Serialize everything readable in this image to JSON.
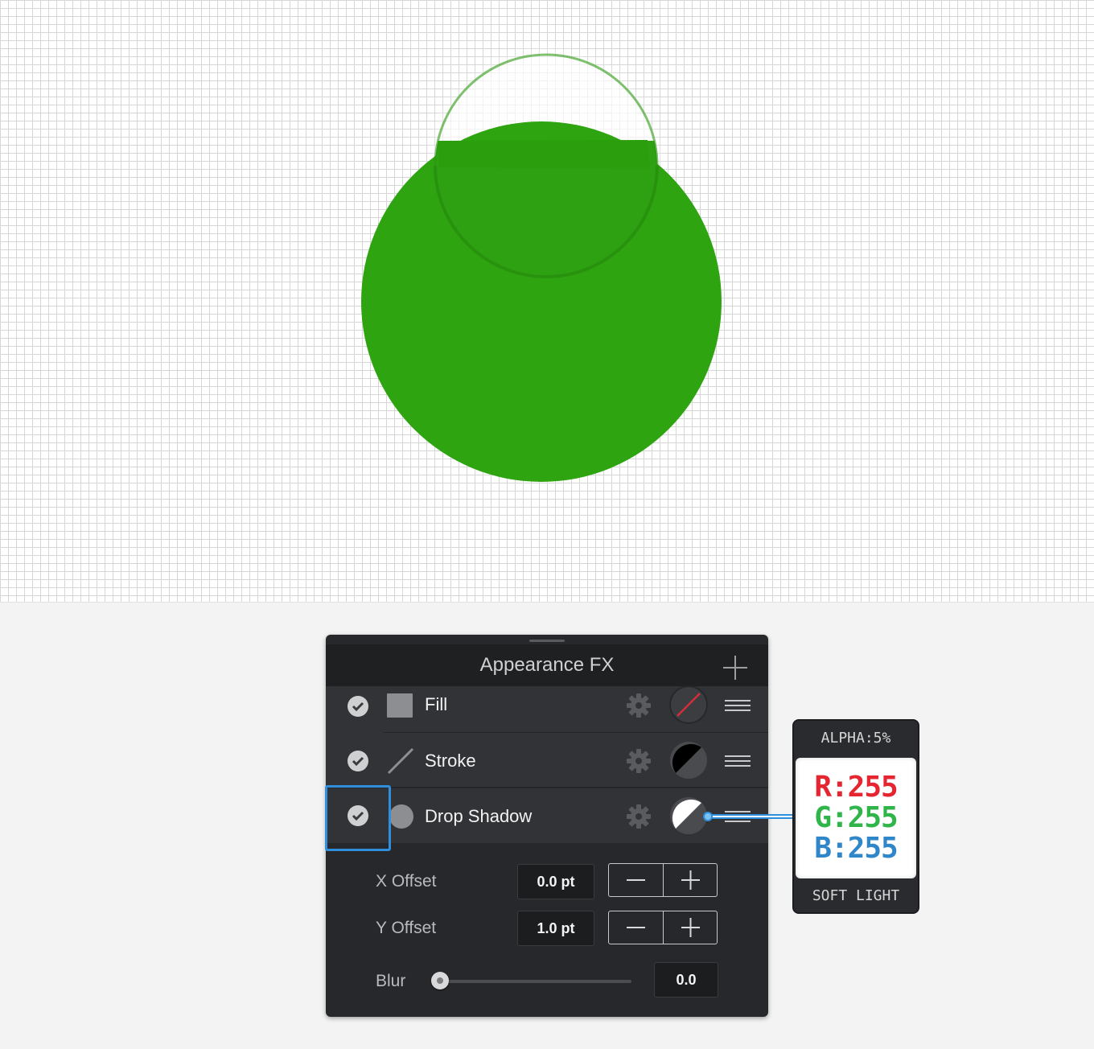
{
  "canvas": {
    "grid_color": "#d6d6d6",
    "shape_color": "#2ea410",
    "inner_shape_color": "#2d9e14"
  },
  "panel": {
    "title": "Appearance FX",
    "add_icon": "plus-icon",
    "rows": [
      {
        "label": "Fill",
        "enabled": true,
        "icon": "fill-square-icon",
        "swatch": "no-color-swatch"
      },
      {
        "label": "Stroke",
        "enabled": true,
        "icon": "stroke-line-icon",
        "swatch": "black-swatch"
      },
      {
        "label": "Drop Shadow",
        "enabled": true,
        "icon": "shadow-circle-icon",
        "swatch": "white-swatch",
        "selected": true
      }
    ],
    "x_offset": {
      "label": "X Offset",
      "value": "0.0 pt"
    },
    "y_offset": {
      "label": "Y Offset",
      "value": "1.0 pt"
    },
    "blur": {
      "label": "Blur",
      "value": "0.0",
      "level": 0
    }
  },
  "callout": {
    "alpha": "ALPHA:5%",
    "r": "R:255",
    "g": "G:255",
    "b": "B:255",
    "blend_mode": "SOFT LIGHT",
    "colors": {
      "r": "#e52530",
      "g": "#2fb54a",
      "b": "#2f86c9"
    }
  }
}
